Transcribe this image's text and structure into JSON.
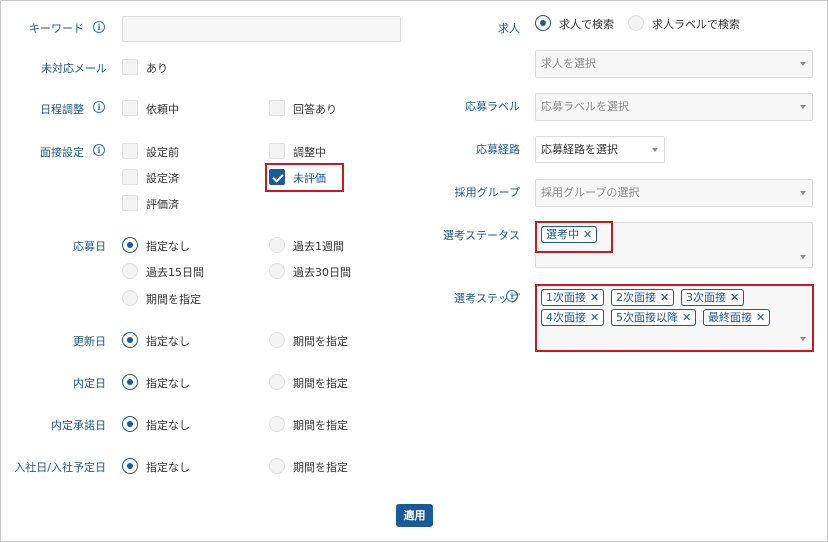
{
  "left": {
    "keyword": {
      "label": "キーワード",
      "value": ""
    },
    "unanswered_mail": {
      "label": "未対応メール",
      "option": "あり"
    },
    "schedule": {
      "label": "日程調整",
      "options": [
        "依頼中",
        "回答あり"
      ]
    },
    "interview_setting": {
      "label": "面接設定",
      "options": [
        "設定前",
        "調整中",
        "設定済",
        "未評価",
        "評価済"
      ]
    },
    "applied_date": {
      "label": "応募日",
      "options": [
        "指定なし",
        "過去1週間",
        "過去15日間",
        "過去30日間",
        "期間を指定"
      ]
    },
    "updated_date": {
      "label": "更新日",
      "options": [
        "指定なし",
        "期間を指定"
      ]
    },
    "offer_date": {
      "label": "内定日",
      "options": [
        "指定なし",
        "期間を指定"
      ]
    },
    "offer_accept_date": {
      "label": "内定承諾日",
      "options": [
        "指定なし",
        "期間を指定"
      ]
    },
    "join_date": {
      "label": "入社日/入社予定日",
      "options": [
        "指定なし",
        "期間を指定"
      ]
    }
  },
  "right": {
    "job": {
      "label": "求人",
      "search_options": [
        "求人で検索",
        "求人ラベルで検索"
      ],
      "select_placeholder": "求人を選択"
    },
    "apply_label": {
      "label": "応募ラベル",
      "placeholder": "応募ラベルを選択"
    },
    "apply_route": {
      "label": "応募経路",
      "placeholder": "応募経路を選択"
    },
    "hiring_group": {
      "label": "採用グループ",
      "placeholder": "採用グループの選択"
    },
    "selection_status": {
      "label": "選考ステータス",
      "tags": [
        "選考中"
      ]
    },
    "selection_step": {
      "label": "選考ステップ",
      "tags": [
        "1次面接",
        "2次面接",
        "3次面接",
        "4次面接",
        "5次面接以降",
        "最終面接"
      ]
    }
  },
  "footer": {
    "apply_button": "適用"
  },
  "colors": {
    "accent": "#195a98",
    "label": "#1d5a8e",
    "highlight": "#d0161e"
  },
  "icons": {
    "info": "info-icon",
    "remove": "close-icon",
    "dropdown": "chevron-down-icon"
  }
}
